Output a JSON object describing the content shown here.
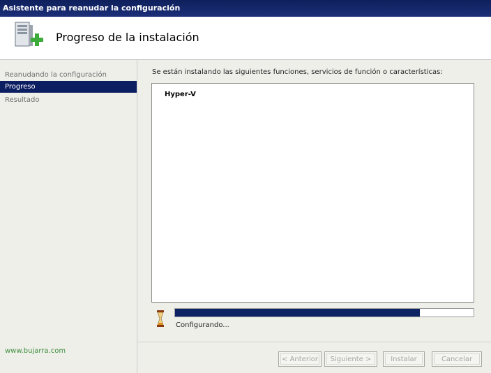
{
  "window": {
    "title": "Asistente para reanudar la configuración"
  },
  "header": {
    "title": "Progreso de la instalación",
    "icon": "server-add-icon"
  },
  "sidebar": {
    "items": [
      {
        "label": "Reanudando la configuración",
        "active": false
      },
      {
        "label": "Progreso",
        "active": true
      },
      {
        "label": "Resultado",
        "active": false
      }
    ],
    "watermark": "www.bujarra.com"
  },
  "main": {
    "description": "Se están instalando las siguientes funciones, servicios de función o características:",
    "features": [
      "Hyper-V"
    ],
    "progress": 0.82,
    "status": "Configurando..."
  },
  "buttons": {
    "back": "< Anterior",
    "next": "Siguiente >",
    "install": "Instalar",
    "cancel": "Cancelar"
  },
  "colors": {
    "titlebar": "#0f1f5c",
    "selection": "#0c1e62",
    "progress": "#0c2265"
  }
}
